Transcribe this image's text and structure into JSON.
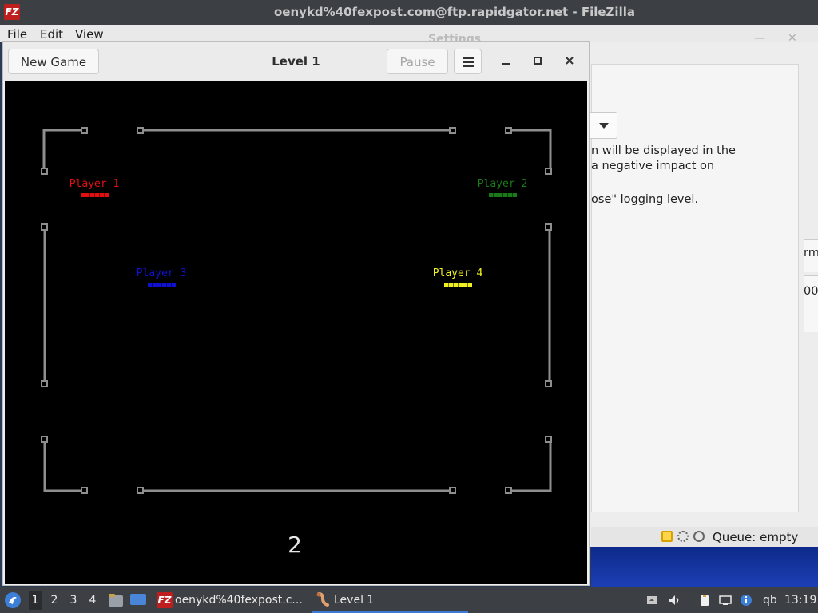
{
  "filezilla": {
    "window_title": "oenykd%40fexpost.com@ftp.rapidgator.net - FileZilla",
    "logo_text": "FZ",
    "menu": [
      "File",
      "Edit",
      "View"
    ],
    "status_queue": "Queue: empty"
  },
  "settings": {
    "title": "Settings",
    "lines": [
      "n will be displayed in the",
      "a negative impact on",
      "ose\" logging level."
    ],
    "side_fragments": [
      "rm",
      "00"
    ]
  },
  "game": {
    "new_game_label": "New Game",
    "title": "Level 1",
    "pause_label": "Pause",
    "countdown": "2",
    "players": [
      {
        "name": "Player 1",
        "color": "#e01010"
      },
      {
        "name": "Player 2",
        "color": "#1a7a1a"
      },
      {
        "name": "Player 3",
        "color": "#1010d0"
      },
      {
        "name": "Player 4",
        "color": "#f0f020"
      }
    ]
  },
  "taskbar": {
    "workspaces": [
      "1",
      "2",
      "3",
      "4"
    ],
    "active_workspace": "1",
    "tasks": [
      {
        "label": "oenykd%40fexpost.c...",
        "icon": "filezilla-icon"
      },
      {
        "label": "Level 1",
        "icon": "nibbles-icon"
      }
    ],
    "tray_qb": "qb",
    "clock": "13:19"
  },
  "colors": {
    "arena_wall": "#8e8e8e",
    "taskbar": "#3c3f43",
    "accent": "#3d7ad6"
  }
}
